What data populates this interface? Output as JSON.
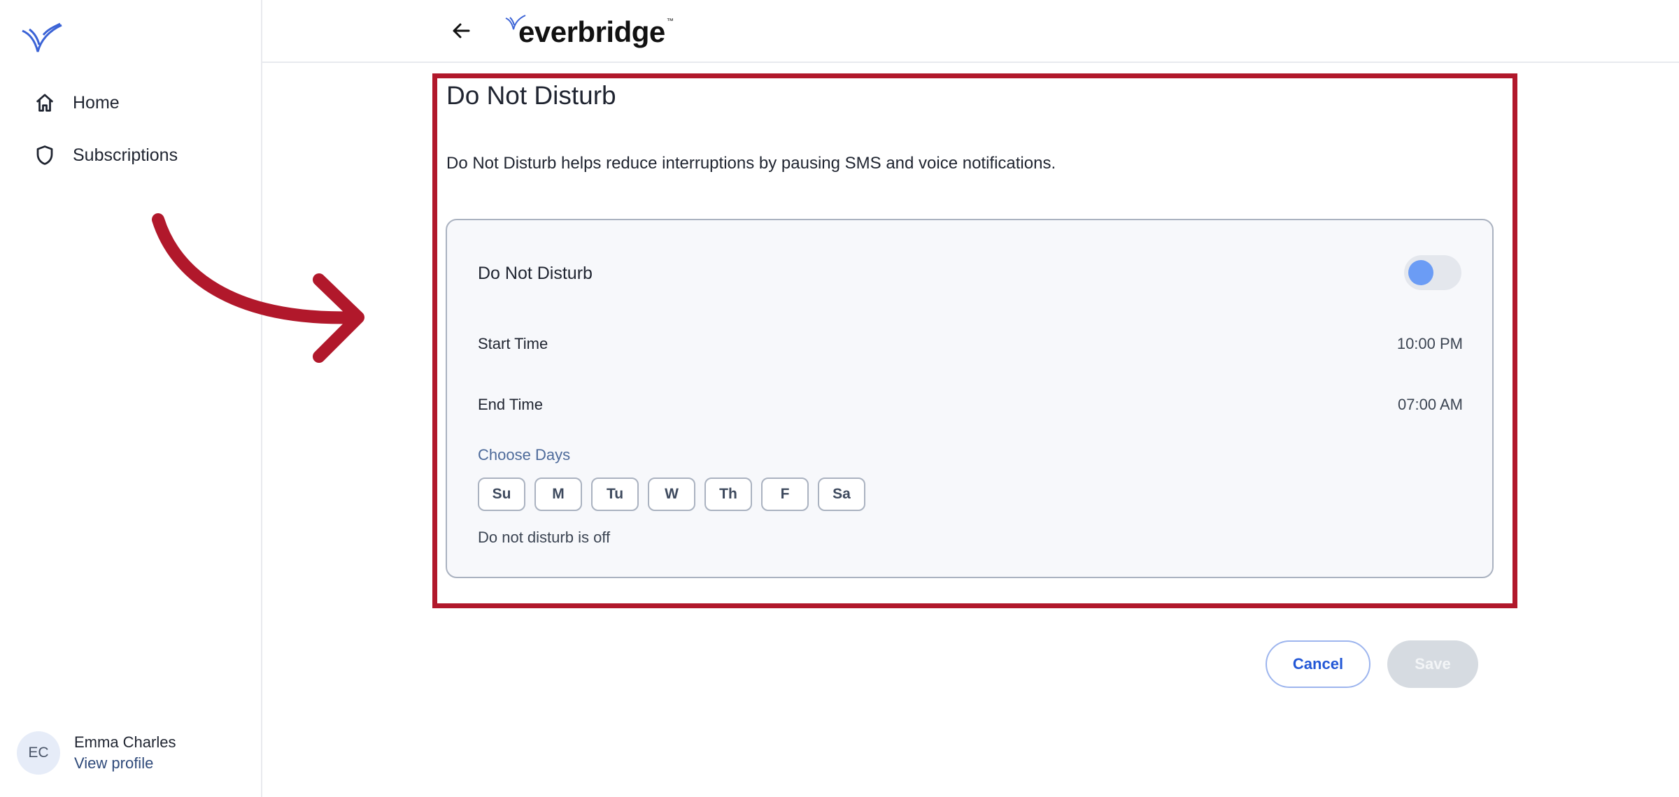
{
  "sidebar": {
    "logo_icon": "everbridge-check-icon",
    "items": [
      {
        "label": "Home",
        "icon": "home-icon"
      },
      {
        "label": "Subscriptions",
        "icon": "shield-icon"
      }
    ],
    "profile": {
      "initials": "EC",
      "name": "Emma Charles",
      "link": "View profile"
    }
  },
  "header": {
    "back_icon": "back-arrow-icon",
    "logo_text": "everbridge",
    "logo_tm": "™"
  },
  "main": {
    "title": "Do Not Disturb",
    "description": "Do Not Disturb helps reduce interruptions by pausing SMS and voice notifications.",
    "card": {
      "toggle_label": "Do Not Disturb",
      "toggle_on": false,
      "start_label": "Start Time",
      "start_value": "10:00 PM",
      "end_label": "End Time",
      "end_value": "07:00 AM",
      "days_label": "Choose Days",
      "days": [
        "Su",
        "M",
        "Tu",
        "W",
        "Th",
        "F",
        "Sa"
      ],
      "status": "Do not disturb is off"
    }
  },
  "footer": {
    "cancel_label": "Cancel",
    "save_label": "Save"
  },
  "colors": {
    "highlight": "#b1182b",
    "accent": "#2257d6",
    "toggle_knob": "#6b9cf5"
  }
}
